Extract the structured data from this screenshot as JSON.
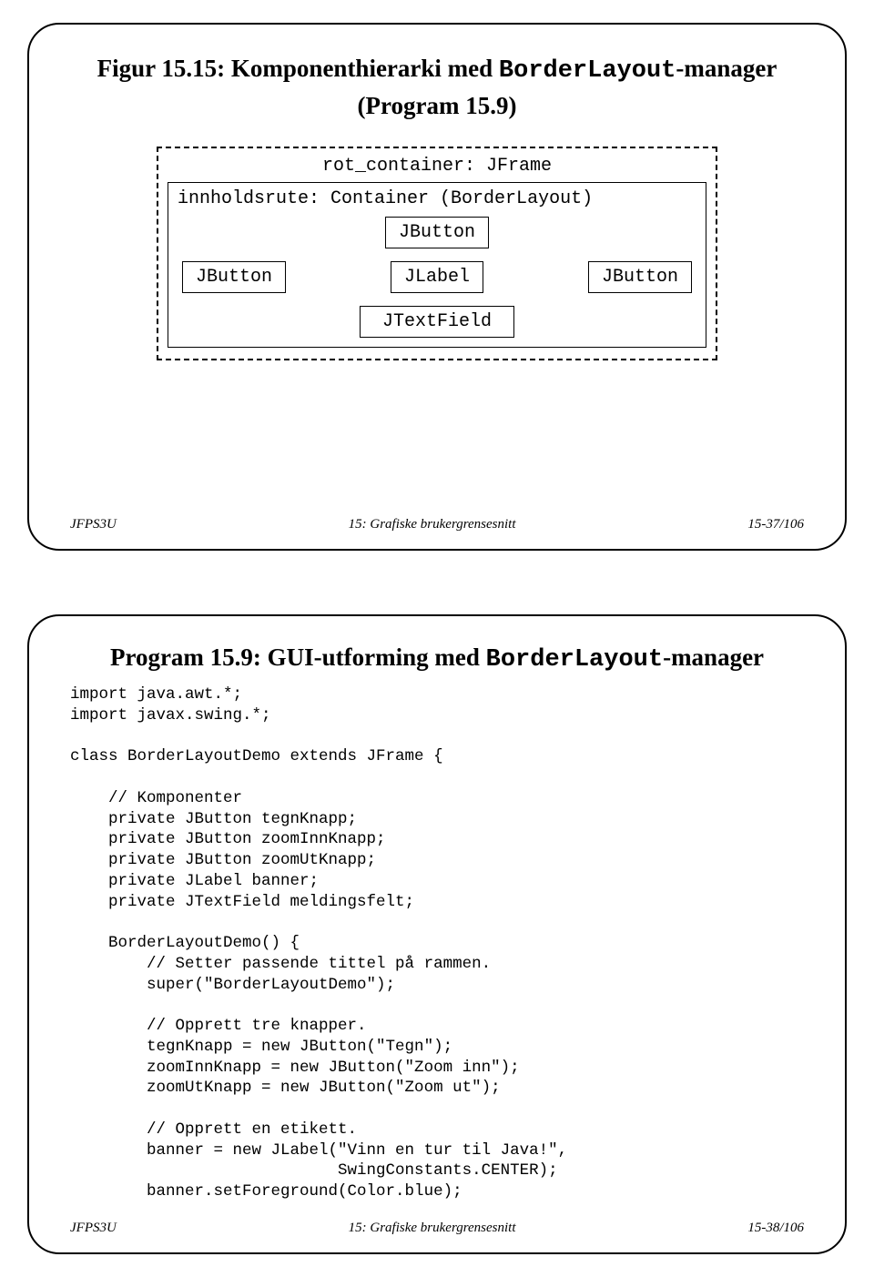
{
  "slide1": {
    "title_prefix": "Figur 15.15: Komponenthierarki med ",
    "title_mono": "BorderLayout",
    "title_suffix": "-manager",
    "subtitle": "(Program 15.9)",
    "diagram": {
      "root_label": "rot_container: JFrame",
      "container_label": "innholdsrute: Container (BorderLayout)",
      "top_component": "JButton",
      "left_component": "JButton",
      "center_component": "JLabel",
      "right_component": "JButton",
      "bottom_component": "JTextField"
    },
    "footer_left": "JFPS3U",
    "footer_center": "15: Grafiske brukergrensesnitt",
    "footer_right": "15-37/106"
  },
  "slide2": {
    "title_prefix": "Program 15.9: GUI-utforming med ",
    "title_mono": "BorderLayout",
    "title_suffix": "-manager",
    "code": "import java.awt.*;\nimport javax.swing.*;\n\nclass BorderLayoutDemo extends JFrame {\n\n    // Komponenter\n    private JButton tegnKnapp;\n    private JButton zoomInnKnapp;\n    private JButton zoomUtKnapp;\n    private JLabel banner;\n    private JTextField meldingsfelt;\n\n    BorderLayoutDemo() {\n        // Setter passende tittel på rammen.\n        super(\"BorderLayoutDemo\");\n\n        // Opprett tre knapper.\n        tegnKnapp = new JButton(\"Tegn\");\n        zoomInnKnapp = new JButton(\"Zoom inn\");\n        zoomUtKnapp = new JButton(\"Zoom ut\");\n\n        // Opprett en etikett.\n        banner = new JLabel(\"Vinn en tur til Java!\",\n                            SwingConstants.CENTER);\n        banner.setForeground(Color.blue);",
    "footer_left": "JFPS3U",
    "footer_center": "15: Grafiske brukergrensesnitt",
    "footer_right": "15-38/106"
  }
}
